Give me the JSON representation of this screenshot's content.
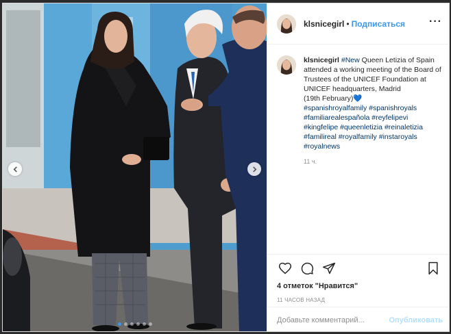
{
  "post": {
    "username": "klsnicegirl",
    "separator": "•",
    "follow_label": "Подписаться",
    "more_icon": "more-horizontal-icon",
    "caption_username": "klsnicegirl",
    "caption_hashtag_first": "#New",
    "caption_text": " Queen Letizia of Spain attended a working meeting of the Board of Trustees of the UNICEF Foundation at UNICEF headquarters, Madrid",
    "caption_date": "(19th February)",
    "caption_heart": "💙",
    "hashtags": [
      "#spanishroyalfamily",
      "#spanishroyals",
      "#familiarealespañola",
      "#reyfelipevi",
      "#kingfelipe",
      "#queenletizia",
      "#reinaletizia",
      "#familireal",
      "#royalfamily",
      "#instaroyals",
      "#royalnews"
    ],
    "comment_time": "11 ч.",
    "likes_text": "4 отметок \"Нравится\"",
    "posted_time": "11 ЧАСОВ НАЗАД",
    "comment_placeholder": "Добавьте комментарий...",
    "publish_label": "Опубликовать"
  },
  "carousel": {
    "slide_count": 6,
    "active_index": 0
  },
  "colors": {
    "accent": "#3897f0",
    "hashtag": "#003569",
    "muted": "#8e8e8e",
    "publish_disabled": "#b2dffc"
  }
}
